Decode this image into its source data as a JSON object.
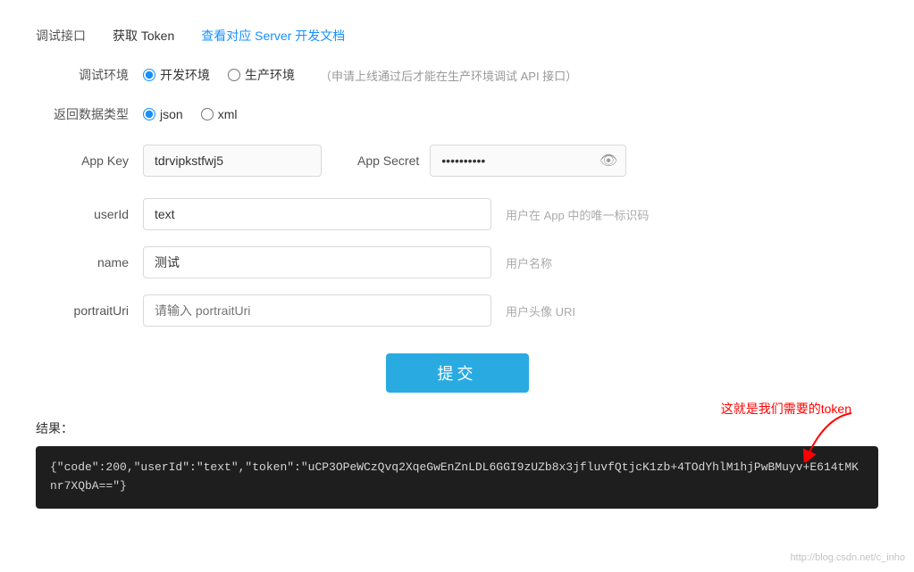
{
  "header": {
    "debug_interface_label": "调试接口",
    "get_token_label": "获取 Token",
    "server_doc_link": "查看对应 Server 开发文档"
  },
  "debug_env": {
    "label": "调试环境",
    "dev_option": "开发环境",
    "prod_option": "生产环境",
    "prod_hint": "（申请上线通过后才能在生产环境调试 API 接口）"
  },
  "return_type": {
    "label": "返回数据类型",
    "json_option": "json",
    "xml_option": "xml"
  },
  "app_key": {
    "label": "App Key",
    "value": "tdrvipkstfwj5"
  },
  "app_secret": {
    "label": "App Secret",
    "placeholder": "**********"
  },
  "fields": [
    {
      "id": "userId",
      "label": "userId",
      "value": "text",
      "placeholder": "",
      "hint": "用户在 App 中的唯一标识码"
    },
    {
      "id": "name",
      "label": "name",
      "value": "测试",
      "placeholder": "",
      "hint": "用户名称"
    },
    {
      "id": "portraitUri",
      "label": "portraitUri",
      "value": "",
      "placeholder": "请输入 portraitUri",
      "hint": "用户头像 URI"
    }
  ],
  "annotation": {
    "text": "这就是我们需要的token"
  },
  "submit": {
    "label": "提交"
  },
  "result": {
    "label": "结果：",
    "value": "{\"code\":200,\"userId\":\"text\",\"token\":\"uCP3OPeWCzQvq2XqeGwEnZnLDL6GGI9zUZb8x3jfluvfQtjcK1zb+4TOdYhlM1hjPwBMuyv+E614tMKnr7XQbA==\"}"
  },
  "watermark": {
    "text": "http://blog.csdn.net/c_inho"
  }
}
